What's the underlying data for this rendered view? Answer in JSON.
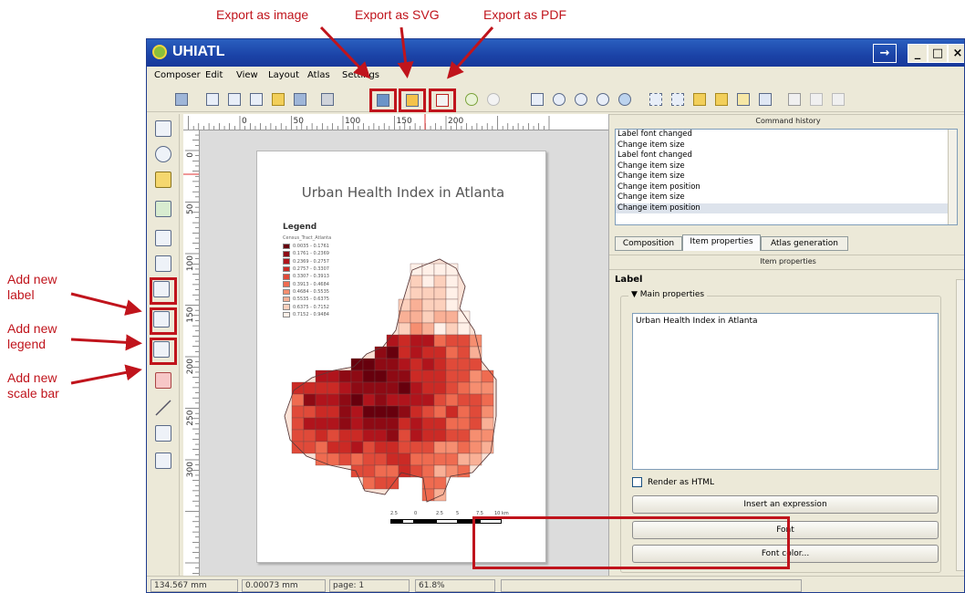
{
  "annotations": {
    "export_image": "Export as image",
    "export_svg": "Export as SVG",
    "export_pdf": "Export as PDF",
    "add_label_1": "Add new",
    "add_label_2": "label",
    "add_legend_1": "Add new",
    "add_legend_2": "legend",
    "add_scalebar_1": "Add new",
    "add_scalebar_2": "scale bar",
    "highlight_color": "#c0141c"
  },
  "window": {
    "title": "UHIATL",
    "controls": {
      "arrow": "→",
      "minimize": "_",
      "maximize": "□",
      "close": "×"
    }
  },
  "menu": [
    "Composer",
    "Edit",
    "View",
    "Layout",
    "Atlas",
    "Settings"
  ],
  "ruler": {
    "top_labels": [
      "0",
      "50",
      "100",
      "150",
      "200"
    ],
    "left_labels": [
      "0",
      "50",
      "100",
      "150",
      "200",
      "250",
      "300"
    ]
  },
  "map": {
    "title": "Urban Health Index in Atlanta",
    "legend_title": "Legend",
    "legend_layer": "Census_Tract_Atlanta",
    "legend_items": [
      {
        "label": "0.0035 - 0.1761",
        "color": "#67000d"
      },
      {
        "label": "0.1761 - 0.2369",
        "color": "#8e0a14"
      },
      {
        "label": "0.2369 - 0.2757",
        "color": "#b0141c"
      },
      {
        "label": "0.2757 - 0.3307",
        "color": "#cb2a25"
      },
      {
        "label": "0.3307 - 0.3913",
        "color": "#e04a39"
      },
      {
        "label": "0.3913 - 0.4684",
        "color": "#ef6b50"
      },
      {
        "label": "0.4684 - 0.5535",
        "color": "#f68e70"
      },
      {
        "label": "0.5535 - 0.6375",
        "color": "#f9b096"
      },
      {
        "label": "0.6375 - 0.7152",
        "color": "#fcd0bc"
      },
      {
        "label": "0.7152 - 0.9484",
        "color": "#fff0e8"
      }
    ],
    "scalebar_labels": [
      "2.5",
      "0",
      "2.5",
      "5",
      "7.5",
      "10 km"
    ]
  },
  "panel": {
    "command_history_title": "Command history",
    "history": [
      "Label font changed",
      "Change item size",
      "Label font changed",
      "Change item size",
      "Change item size",
      "Change item position",
      "Change item size",
      "Change item position"
    ],
    "tabs": [
      "Composition",
      "Item properties",
      "Atlas generation"
    ],
    "active_tab": "Item properties",
    "item_properties_title": "Item properties",
    "section": "Label",
    "group": "Main properties",
    "label_text": "Urban Health Index in Atlanta",
    "render_html": "Render as HTML",
    "insert_expression": "Insert an expression",
    "font": "Font",
    "font_color": "Font color..."
  },
  "status": {
    "x": "134.567 mm",
    "y": "0.00073 mm",
    "page": "page: 1",
    "zoom": "61.8%"
  }
}
